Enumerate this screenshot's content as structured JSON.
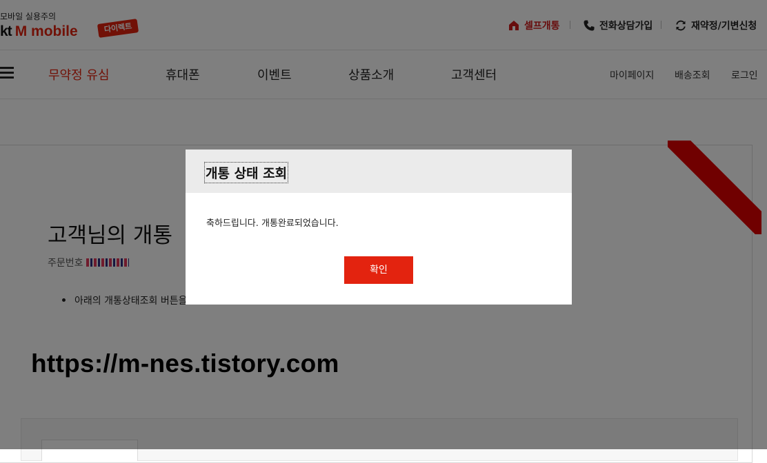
{
  "header": {
    "tagline": "모바일 실용주의",
    "logo_kt": "kt",
    "logo_mm": "M mobile",
    "badge": "다이렉트",
    "util": {
      "self_open": "셀프개통",
      "call_signup": "전화상담가입",
      "change": "재약정/기변신청"
    },
    "colors": {
      "brand_red": "#e3230f"
    }
  },
  "gnb": {
    "menu_icon": "hamburger-icon",
    "items": [
      "무약정 유심",
      "휴대폰",
      "이벤트",
      "상품소개",
      "고객센터"
    ],
    "active_index": 0,
    "util_links": [
      "마이페이지",
      "배송조회",
      "로그인"
    ]
  },
  "content": {
    "heading": "고객님의 개통",
    "order_label": "주문번호",
    "bullet": "아래의 개통상태조회 버튼을",
    "watermark": "https://m-nes.tistory.com"
  },
  "modal": {
    "title": "개통 상태 조회",
    "message": "축하드립니다. 개통완료되었습니다.",
    "confirm": "확인"
  }
}
